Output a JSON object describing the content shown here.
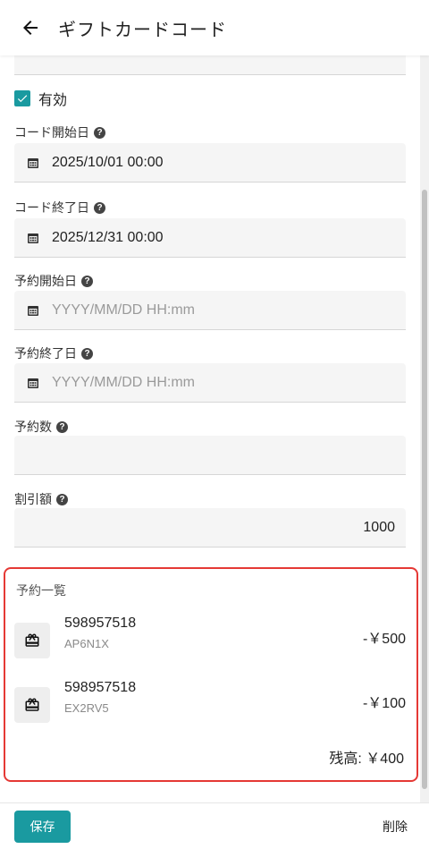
{
  "header": {
    "title": "ギフトカードコード",
    "back_icon": "arrow-back-icon"
  },
  "form": {
    "active": {
      "label": "有効",
      "checked": true
    },
    "fields": [
      {
        "label": "コード開始日",
        "value": "2025/10/01 00:00",
        "placeholder": ""
      },
      {
        "label": "コード終了日",
        "value": "2025/12/31 00:00",
        "placeholder": ""
      },
      {
        "label": "予約開始日",
        "value": "",
        "placeholder": "YYYY/MM/DD HH:mm"
      },
      {
        "label": "予約終了日",
        "value": "",
        "placeholder": "YYYY/MM/DD HH:mm"
      },
      {
        "label": "予約数",
        "value": ""
      },
      {
        "label": "割引額",
        "value": "1000"
      }
    ],
    "help_glyph": "?"
  },
  "reservations": {
    "title": "予約一覧",
    "items": [
      {
        "id": "598957518",
        "code": "AP6N1X",
        "amount": "-￥500",
        "icon": "gift-icon"
      },
      {
        "id": "598957518",
        "code": "EX2RV5",
        "amount": "-￥100",
        "icon": "gift-icon"
      }
    ],
    "balance": "残高: ￥400"
  },
  "actions": {
    "save": "保存",
    "delete": "削除"
  },
  "colors": {
    "accent": "#1a9aa0",
    "highlight_border": "#e53935"
  }
}
